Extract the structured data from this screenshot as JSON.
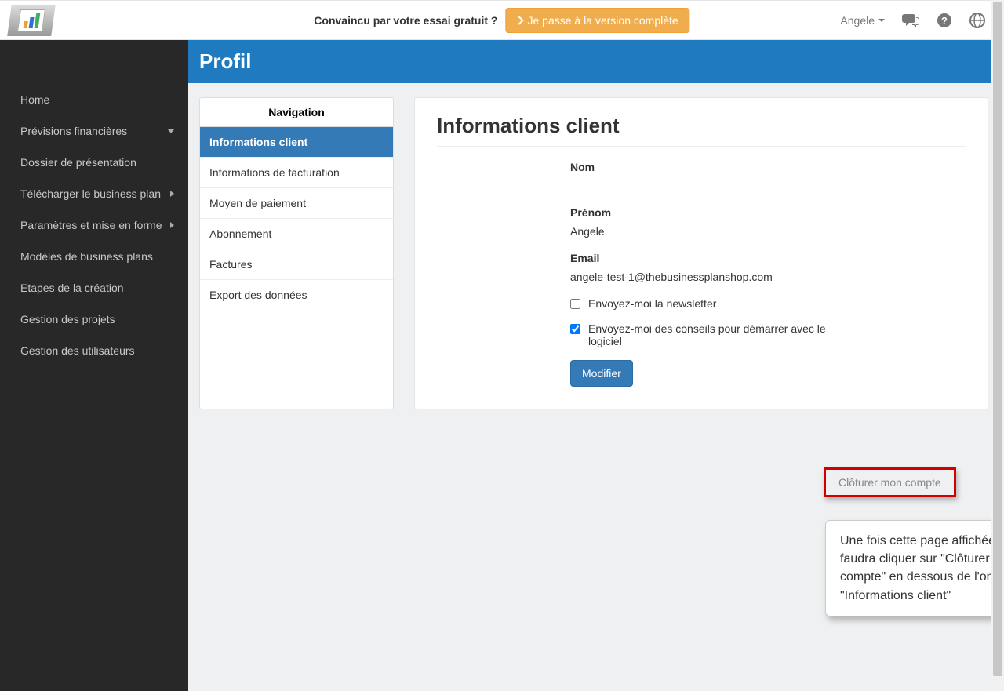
{
  "topbar": {
    "trial_text": "Convaincu par votre essai gratuit ?",
    "upgrade_label": "Je passe à la version complète",
    "user_name": "Angele"
  },
  "sidebar": {
    "items": [
      {
        "label": "Home",
        "arrow": null
      },
      {
        "label": "Prévisions financières",
        "arrow": "down"
      },
      {
        "label": "Dossier de présentation",
        "arrow": null
      },
      {
        "label": "Télécharger le business plan",
        "arrow": "right"
      },
      {
        "label": "Paramètres et mise en forme",
        "arrow": "right"
      },
      {
        "label": "Modèles de business plans",
        "arrow": null
      },
      {
        "label": "Etapes de la création",
        "arrow": null
      },
      {
        "label": "Gestion des projets",
        "arrow": null
      },
      {
        "label": "Gestion des utilisateurs",
        "arrow": null
      }
    ]
  },
  "page": {
    "title": "Profil"
  },
  "profile_nav": {
    "header": "Navigation",
    "items": [
      {
        "label": "Informations client",
        "active": true
      },
      {
        "label": "Informations de facturation",
        "active": false
      },
      {
        "label": "Moyen de paiement",
        "active": false
      },
      {
        "label": "Abonnement",
        "active": false
      },
      {
        "label": "Factures",
        "active": false
      },
      {
        "label": "Export des données",
        "active": false
      }
    ]
  },
  "client_info": {
    "heading": "Informations client",
    "nom_label": "Nom",
    "nom_value": "",
    "prenom_label": "Prénom",
    "prenom_value": "Angele",
    "email_label": "Email",
    "email_value": "angele-test-1@thebusinessplanshop.com",
    "newsletter_label": "Envoyez-moi la newsletter",
    "newsletter_checked": false,
    "tips_label": "Envoyez-moi des conseils pour démarrer avec le logiciel",
    "tips_checked": true,
    "modify_label": "Modifier"
  },
  "close_account": {
    "label": "Clôturer mon compte"
  },
  "tooltip": {
    "text": "Une fois cette page affichée, il vous faudra cliquer sur \"Clôturer mon compte\" en dessous de l'onglet \"Informations client\""
  }
}
